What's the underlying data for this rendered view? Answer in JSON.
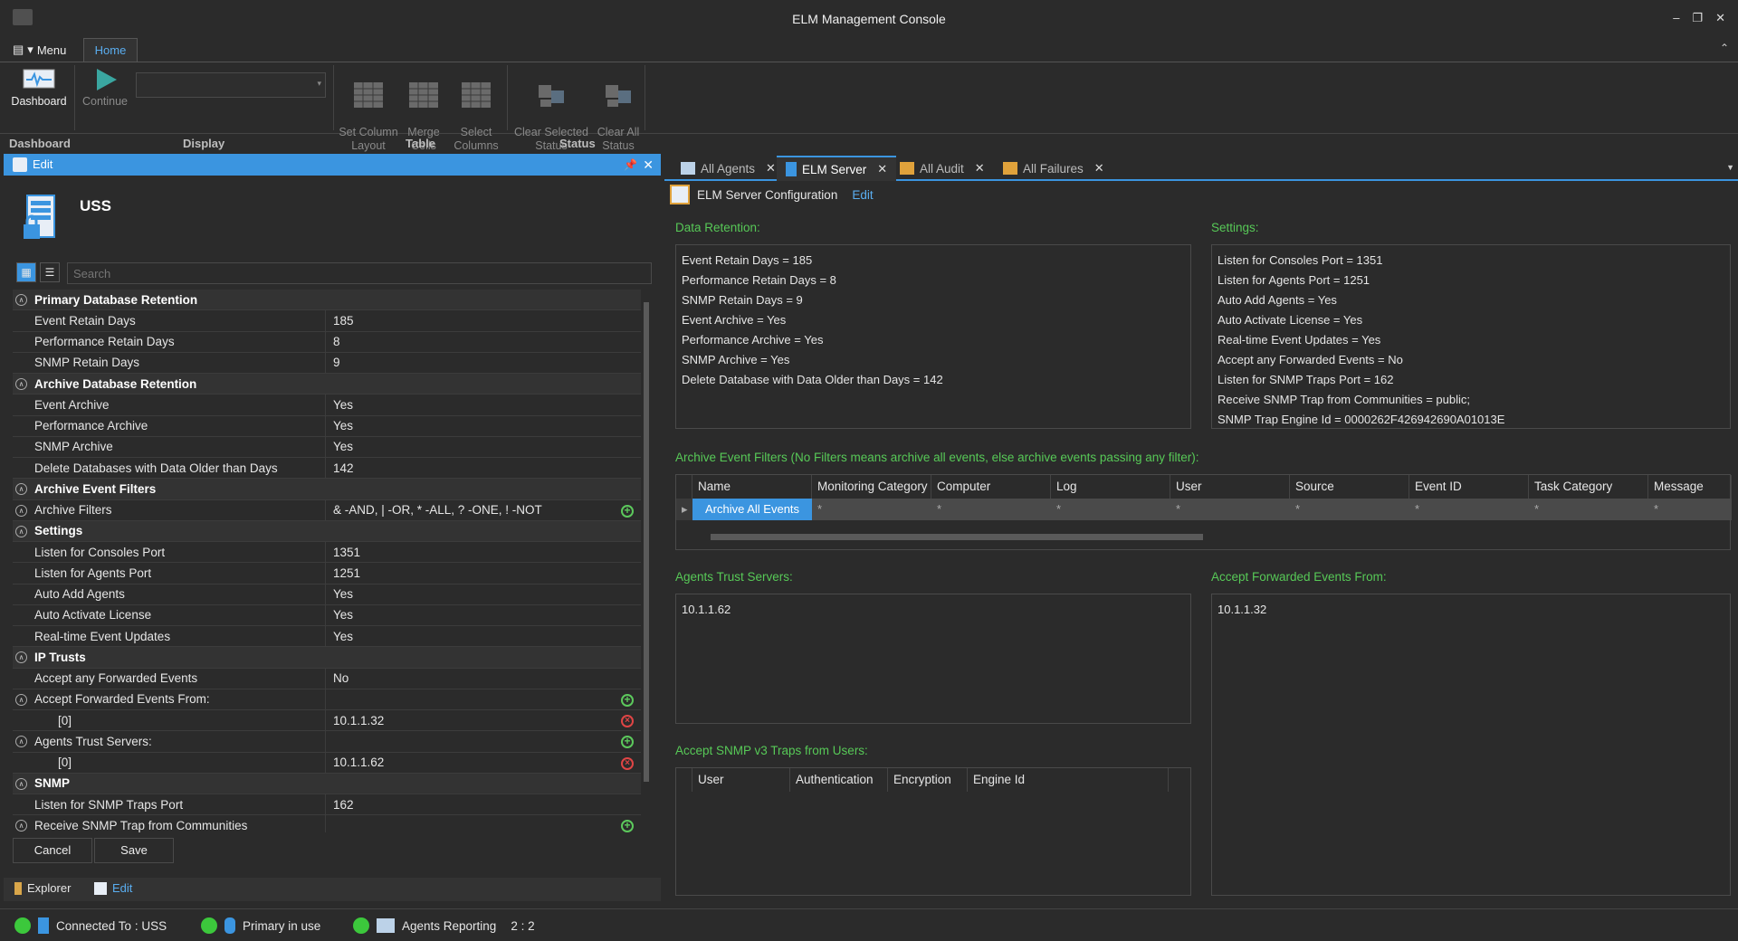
{
  "window": {
    "title": "ELM Management Console"
  },
  "ribbon": {
    "menu_label": "Menu",
    "home_tab": "Home",
    "buttons": {
      "dashboard": "Dashboard",
      "continue": "Continue",
      "set_column_layout": "Set Column\nLayout",
      "merge_cells": "Merge\nCells",
      "select_columns": "Select\nColumns",
      "clear_selected_status": "Clear Selected\nStatus",
      "clear_all_status": "Clear All\nStatus"
    },
    "groups": {
      "dashboard": "Dashboard",
      "display": "Display",
      "table": "Table",
      "status": "Status"
    }
  },
  "edit_panel": {
    "header": "Edit",
    "title": "USS",
    "search_placeholder": "Search",
    "rows": [
      {
        "type": "cat",
        "name": "Primary Database Retention"
      },
      {
        "type": "prop",
        "name": "Event Retain Days",
        "value": "185"
      },
      {
        "type": "prop",
        "name": "Performance Retain Days",
        "value": "8"
      },
      {
        "type": "prop",
        "name": "SNMP Retain Days",
        "value": "9"
      },
      {
        "type": "cat",
        "name": "Archive Database Retention"
      },
      {
        "type": "prop",
        "name": "Event Archive",
        "value": "Yes"
      },
      {
        "type": "prop",
        "name": "Performance Archive",
        "value": "Yes"
      },
      {
        "type": "prop",
        "name": "SNMP Archive",
        "value": "Yes"
      },
      {
        "type": "prop",
        "name": "Delete Databases with Data Older than Days",
        "value": "142"
      },
      {
        "type": "cat",
        "name": "Archive Event Filters"
      },
      {
        "type": "sub",
        "name": "Archive Filters",
        "value": "& -AND, | -OR, * -ALL, ? -ONE, ! -NOT",
        "action": "add"
      },
      {
        "type": "cat",
        "name": "Settings"
      },
      {
        "type": "prop",
        "name": "Listen for Consoles Port",
        "value": "1351"
      },
      {
        "type": "prop",
        "name": "Listen for Agents Port",
        "value": "1251"
      },
      {
        "type": "prop",
        "name": "Auto Add Agents",
        "value": "Yes"
      },
      {
        "type": "prop",
        "name": "Auto Activate License",
        "value": "Yes"
      },
      {
        "type": "prop",
        "name": "Real-time Event Updates",
        "value": "Yes"
      },
      {
        "type": "cat",
        "name": "IP Trusts"
      },
      {
        "type": "prop",
        "name": "Accept any Forwarded Events",
        "value": "No"
      },
      {
        "type": "sub",
        "name": "Accept Forwarded Events From:",
        "value": "",
        "action": "add"
      },
      {
        "type": "child",
        "name": "[0]",
        "value": "10.1.1.32",
        "action": "del"
      },
      {
        "type": "sub",
        "name": "Agents Trust Servers:",
        "value": "",
        "action": "add"
      },
      {
        "type": "child",
        "name": "[0]",
        "value": "10.1.1.62",
        "action": "del"
      },
      {
        "type": "cat",
        "name": "SNMP"
      },
      {
        "type": "prop",
        "name": "Listen for SNMP Traps Port",
        "value": "162"
      },
      {
        "type": "sub",
        "name": "Receive SNMP Trap from Communities",
        "value": "",
        "action": "add"
      }
    ],
    "cancel": "Cancel",
    "save": "Save",
    "bottom_tabs": {
      "explorer": "Explorer",
      "edit": "Edit"
    }
  },
  "status_bar": {
    "connected": "Connected To : USS",
    "primary": "Primary in use",
    "agents": "Agents Reporting",
    "agents_count": "2 : 2"
  },
  "doc_tabs": {
    "all_agents": "All Agents",
    "elm_server": "ELM Server",
    "all_audit": "All Audit",
    "all_failures": "All Failures"
  },
  "config": {
    "header": "ELM Server Configuration",
    "edit_link": "Edit",
    "data_retention_label": "Data Retention:",
    "data_retention": [
      "Event Retain Days = 185",
      "Performance Retain Days = 8",
      "SNMP Retain Days = 9",
      "Event Archive = Yes",
      "Performance Archive = Yes",
      "SNMP Archive = Yes",
      "Delete Database with Data Older than Days = 142"
    ],
    "settings_label": "Settings:",
    "settings": [
      "Listen for Consoles Port = 1351",
      "Listen for Agents Port = 1251",
      "Auto Add Agents = Yes",
      "Auto Activate License = Yes",
      "Real-time Event Updates = Yes",
      "Accept any Forwarded Events = No",
      "Listen for SNMP Traps Port = 162",
      "Receive SNMP Trap from Communities = public;",
      "SNMP Trap Engine Id = 0000262F426942690A01013E"
    ],
    "filters_label": "Archive Event Filters (No Filters means archive all events, else archive events passing any filter):",
    "filter_columns": [
      "Name",
      "Monitoring Category",
      "Computer",
      "Log",
      "User",
      "Source",
      "Event ID",
      "Task Category",
      "Message"
    ],
    "filter_row": [
      "Archive All Events",
      "*",
      "*",
      "*",
      "*",
      "*",
      "*",
      "*",
      "*"
    ],
    "agents_trust_label": "Agents Trust Servers:",
    "agents_trust": "10.1.1.62",
    "accept_fwd_label": "Accept Forwarded Events From:",
    "accept_fwd": "10.1.1.32",
    "snmp_users_label": "Accept SNMP v3 Traps from Users:",
    "snmp_columns": [
      "User",
      "Authentication",
      "Encryption",
      "Engine Id"
    ]
  }
}
